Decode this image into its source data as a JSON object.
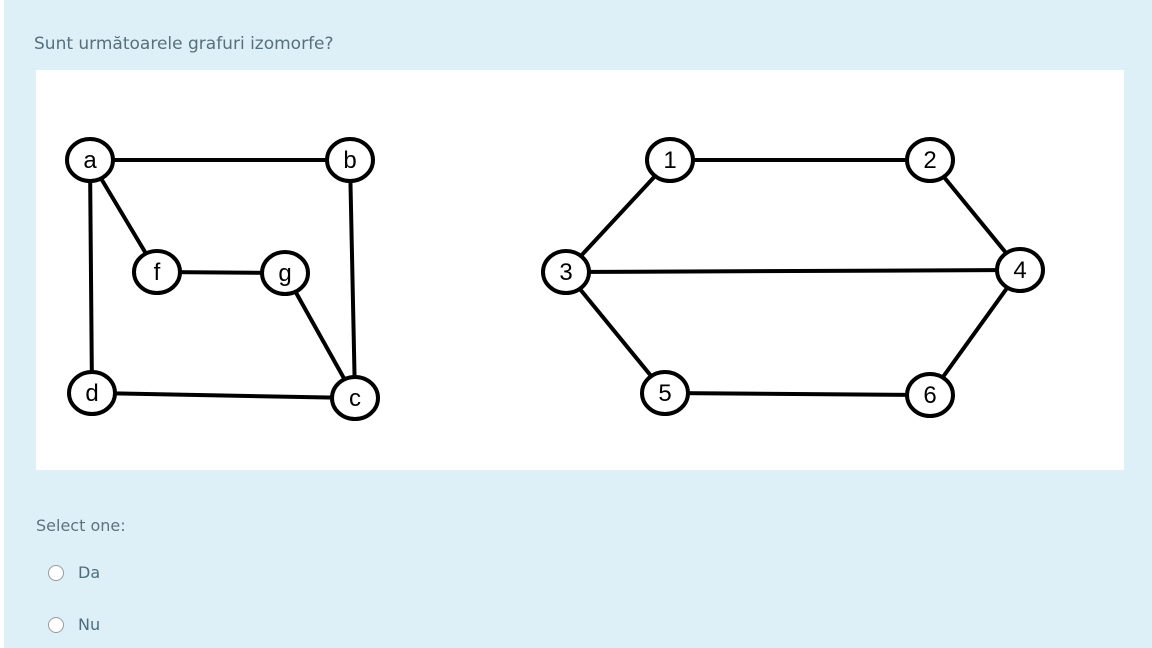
{
  "question": "Sunt următoarele grafuri izomorfe?",
  "graph_left": {
    "nodes": [
      {
        "id": "a",
        "label": "a"
      },
      {
        "id": "b",
        "label": "b"
      },
      {
        "id": "f",
        "label": "f"
      },
      {
        "id": "g",
        "label": "g"
      },
      {
        "id": "d",
        "label": "d"
      },
      {
        "id": "c",
        "label": "c"
      }
    ],
    "edges": [
      [
        "a",
        "b"
      ],
      [
        "a",
        "f"
      ],
      [
        "a",
        "d"
      ],
      [
        "b",
        "c"
      ],
      [
        "f",
        "g"
      ],
      [
        "g",
        "c"
      ],
      [
        "d",
        "c"
      ]
    ]
  },
  "graph_right": {
    "nodes": [
      {
        "id": "1",
        "label": "1"
      },
      {
        "id": "2",
        "label": "2"
      },
      {
        "id": "3",
        "label": "3"
      },
      {
        "id": "4",
        "label": "4"
      },
      {
        "id": "5",
        "label": "5"
      },
      {
        "id": "6",
        "label": "6"
      }
    ],
    "edges": [
      [
        "1",
        "2"
      ],
      [
        "1",
        "3"
      ],
      [
        "2",
        "4"
      ],
      [
        "3",
        "4"
      ],
      [
        "3",
        "5"
      ],
      [
        "4",
        "6"
      ],
      [
        "5",
        "6"
      ]
    ]
  },
  "answer": {
    "prompt": "Select one:",
    "options": [
      {
        "label": "Da",
        "selected": false
      },
      {
        "label": "Nu",
        "selected": false
      }
    ]
  }
}
